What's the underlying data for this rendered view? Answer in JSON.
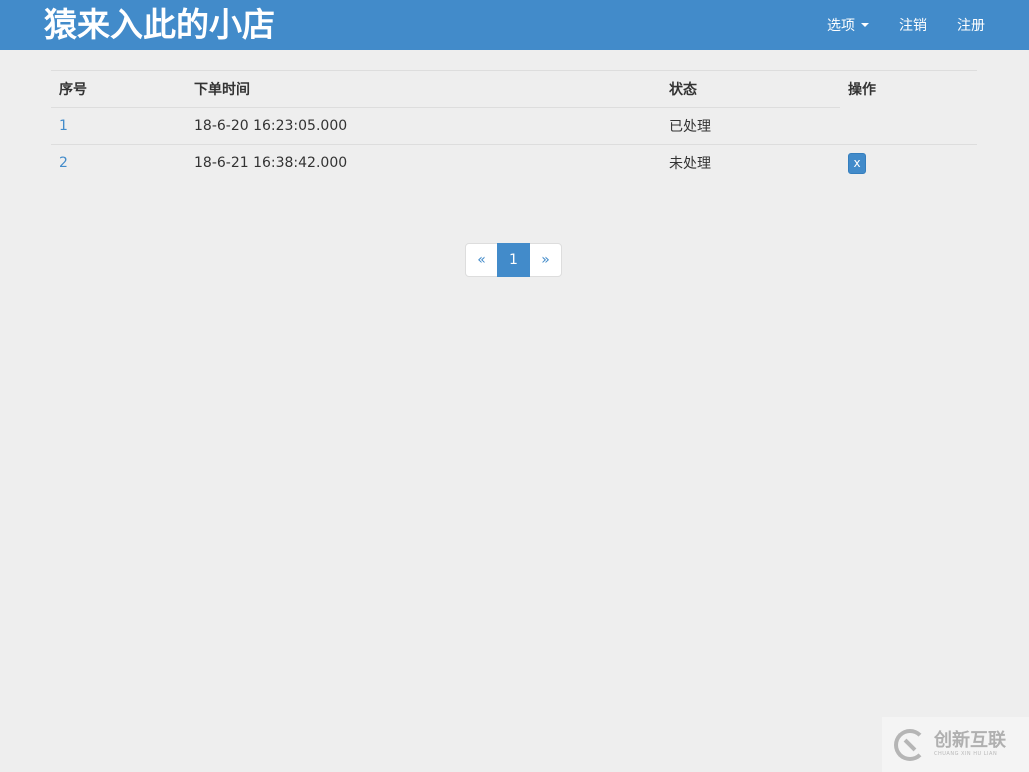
{
  "navbar": {
    "brand": "猿来入此的小店",
    "options_label": "选项",
    "logout_label": "注销",
    "register_label": "注册"
  },
  "table": {
    "headers": {
      "index": "序号",
      "order_time": "下单时间",
      "status": "状态",
      "action": "操作"
    },
    "rows": [
      {
        "index": "1",
        "order_time": "18-6-20 16:23:05.000",
        "status": "已处理",
        "action": ""
      },
      {
        "index": "2",
        "order_time": "18-6-21 16:38:42.000",
        "status": "未处理",
        "action": "x"
      }
    ]
  },
  "pagination": {
    "prev": "«",
    "current": "1",
    "next": "»"
  },
  "watermark": {
    "main": "创新互联",
    "sub": "CHUANG XIN HU LIAN"
  },
  "colors": {
    "primary": "#428bca",
    "background": "#eeeeee"
  }
}
